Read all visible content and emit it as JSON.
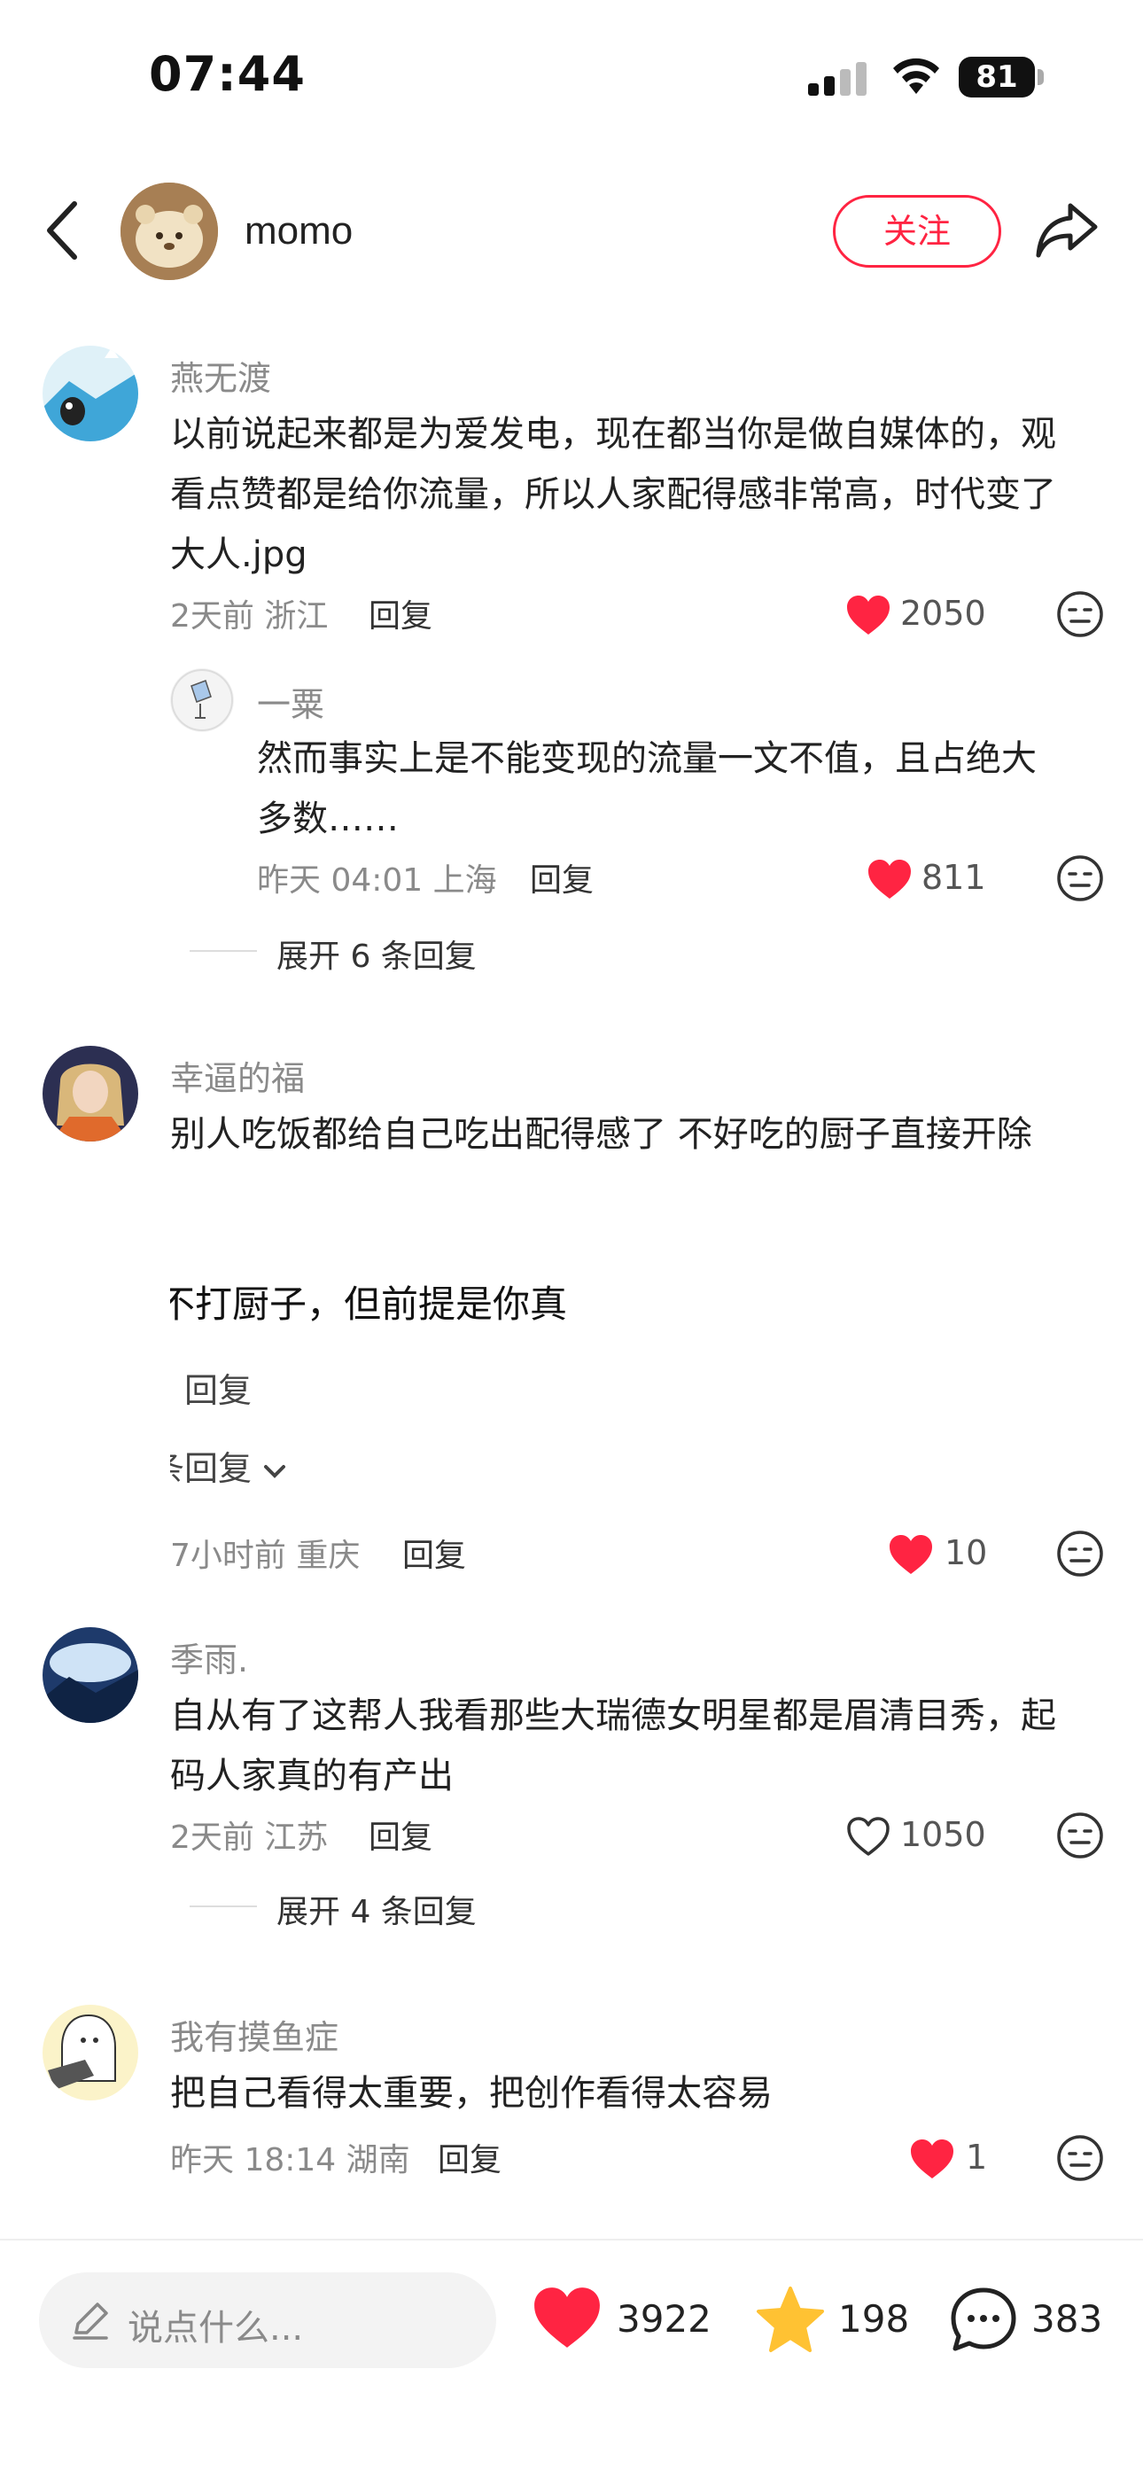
{
  "status_bar": {
    "time": "07:44",
    "battery": "81"
  },
  "header": {
    "author_name": "momo",
    "follow_label": "关注"
  },
  "comments": [
    {
      "username": "燕无渡",
      "lines": [
        "以前说起来都是为爱发电，现在都当你是做自媒体的，观",
        "看点赞都是给你流量，所以人家配得感非常高，时代变了",
        "大人.jpg"
      ],
      "meta": "2天前 浙江",
      "reply_label": "回复",
      "likes": "2050",
      "liked": true,
      "replies": [
        {
          "username": "一粟",
          "lines": [
            "然而事实上是不能变现的流量一文不值，且占绝大",
            "多数……"
          ],
          "meta": "昨天 04:01 上海",
          "reply_label": "回复",
          "likes": "811",
          "liked": true
        }
      ],
      "expand_label": "展开 6 条回复"
    },
    {
      "username": "幸逼的福",
      "lines": [
        "别人吃饭都给自己吃出配得感了 不好吃的厨子直接开除"
      ],
      "overlay_text": "不打厨子，但前提是你真",
      "overlay_reply": "回复",
      "overlay_expand": "条回复",
      "meta": "7小时前 重庆",
      "reply_label": "回复",
      "likes": "10",
      "liked": true
    },
    {
      "username": "季雨.",
      "lines": [
        "自从有了这帮人我看那些大瑞德女明星都是眉清目秀，起",
        "码人家真的有产出"
      ],
      "meta": "2天前 江苏",
      "reply_label": "回复",
      "likes": "1050",
      "liked": false,
      "expand_label": "展开 4 条回复"
    },
    {
      "username": "我有摸鱼症",
      "lines": [
        "把自己看得太重要，把创作看得太容易"
      ],
      "meta": "昨天 18:14 湖南",
      "reply_label": "回复",
      "likes": "1",
      "liked": true
    }
  ],
  "bottom_bar": {
    "placeholder": "说点什么...",
    "likes": "3922",
    "stars": "198",
    "comments": "383"
  },
  "colors": {
    "accent": "#ff2442",
    "star": "#ffc233",
    "muted": "#8a8a8a"
  }
}
